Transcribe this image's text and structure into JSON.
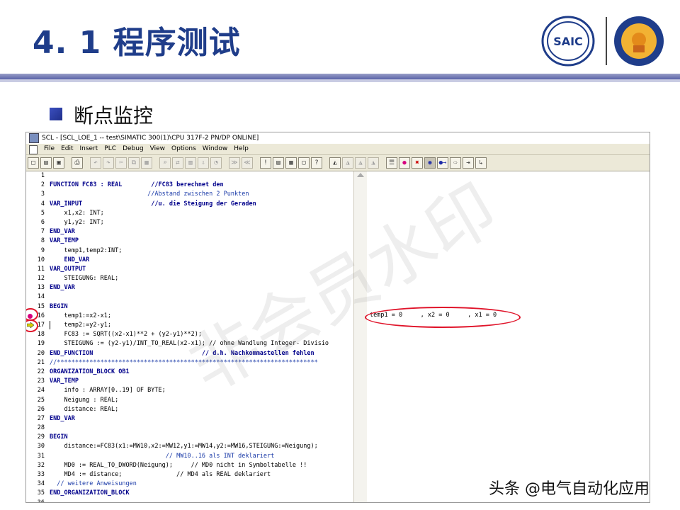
{
  "slide": {
    "title": "4. 1  程序测试",
    "subtitle": "断点监控",
    "credit": "头条 @电气自动化应用",
    "watermark": "非会员水印",
    "logo": {
      "brand_text": "SAIC"
    }
  },
  "window": {
    "title": "SCL  - [SCL_LOE_1 -- test\\SIMATIC 300(1)\\CPU 317F-2 PN/DP  ONLINE]",
    "menus": [
      "File",
      "Edit",
      "Insert",
      "PLC",
      "Debug",
      "View",
      "Options",
      "Window",
      "Help"
    ]
  },
  "colors": {
    "title": "#1f3d8a",
    "breakpoint": "#d6007e",
    "highlight": "#e0142a"
  },
  "code": {
    "lines": [
      {
        "n": "1",
        "t": ""
      },
      {
        "n": "2",
        "t": "FUNCTION FC83 : REAL        //FC83 berechnet den"
      },
      {
        "n": "3",
        "t": "                           //Abstand zwischen 2 Punkten"
      },
      {
        "n": "4",
        "t": "VAR_INPUT                   //u. die Steigung der Geraden"
      },
      {
        "n": "5",
        "t": "    x1,x2: INT;"
      },
      {
        "n": "6",
        "t": "    y1,y2: INT;"
      },
      {
        "n": "7",
        "t": "END_VAR"
      },
      {
        "n": "8",
        "t": "VAR_TEMP"
      },
      {
        "n": "9",
        "t": "    temp1,temp2:INT;"
      },
      {
        "n": "10",
        "t": "    END_VAR"
      },
      {
        "n": "11",
        "t": "VAR_OUTPUT"
      },
      {
        "n": "12",
        "t": "    STEIGUNG: REAL;"
      },
      {
        "n": "13",
        "t": "END_VAR"
      },
      {
        "n": "14",
        "t": ""
      },
      {
        "n": "15",
        "t": "BEGIN"
      },
      {
        "n": "16",
        "t": "    temp1:=x2-x1;"
      },
      {
        "n": "17",
        "t": "    temp2:=y2-y1;"
      },
      {
        "n": "18",
        "t": "    FC83 := SQRT((x2-x1)**2 + (y2-y1)**2);"
      },
      {
        "n": "19",
        "t": "    STEIGUNG := (y2-y1)/INT_TO_REAL(x2-x1); // ohne Wandlung Integer- Divisio"
      },
      {
        "n": "20",
        "t": "END_FUNCTION                              // d.h. Nachkommastellen fehlen"
      },
      {
        "n": "21",
        "t": "//************************************************************************"
      },
      {
        "n": "22",
        "t": "ORGANIZATION_BLOCK OB1"
      },
      {
        "n": "23",
        "t": "VAR_TEMP"
      },
      {
        "n": "24",
        "t": "    info : ARRAY[0..19] OF BYTE;"
      },
      {
        "n": "25",
        "t": "    Neigung : REAL;"
      },
      {
        "n": "26",
        "t": "    distance: REAL;"
      },
      {
        "n": "27",
        "t": "END_VAR"
      },
      {
        "n": "28",
        "t": ""
      },
      {
        "n": "29",
        "t": "BEGIN"
      },
      {
        "n": "30",
        "t": "    distance:=FC83(x1:=MW10,x2:=MW12,y1:=MW14,y2:=MW16,STEIGUNG:=Neigung);"
      },
      {
        "n": "31",
        "t": "                                // MW10..16 als INT deklariert"
      },
      {
        "n": "32",
        "t": "    MD0 := REAL_TO_DWORD(Neigung);     // MD0 nicht in Symboltabelle !!"
      },
      {
        "n": "33",
        "t": "    MD4 := distance;               // MD4 als REAL deklariert"
      },
      {
        "n": "34",
        "t": "  // weitere Anweisungen"
      },
      {
        "n": "35",
        "t": "END_ORGANIZATION_BLOCK"
      },
      {
        "n": "36",
        "t": ""
      }
    ]
  },
  "monitor": {
    "line16": "temp1 = 0     , x2 = 0     , x1 = 0"
  }
}
